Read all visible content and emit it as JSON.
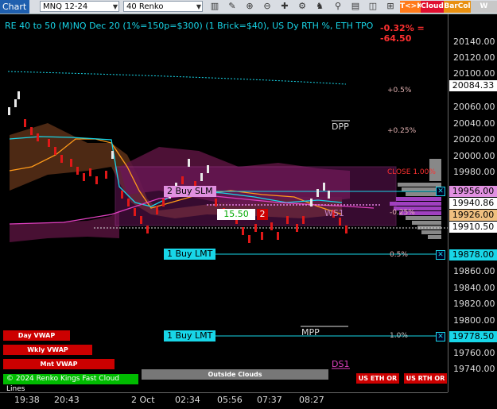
{
  "toolbar": {
    "chart_label": "Chart",
    "instrument": "MNQ 12-24",
    "bar_type": "40 Renko",
    "buttons": {
      "tk": "T<>K",
      "cloud": "Cloud",
      "barcol": "BarCol",
      "vwap": "W VWA"
    }
  },
  "chart": {
    "title": "RE 40 to 50 (M)NQ Dec 20 (1%=150p=$300) (1 Brick=$40), US Dy RTH %, ETH TPO",
    "change": "-0.32% = -64.50",
    "colors": {
      "cyan": "#18d6e8",
      "orange": "#ff9a1a",
      "magenta": "#e040c0",
      "red": "#e01818",
      "white": "#e0e0e0"
    }
  },
  "price_axis": {
    "labels": [
      "20140.00",
      "20120.00",
      "20100.00",
      "20084.33",
      "20060.00",
      "20040.00",
      "20020.00",
      "20000.00",
      "19980.00",
      "19956.00",
      "19940.86",
      "19926.00",
      "19910.50",
      "19878.00",
      "19860.00",
      "19840.00",
      "19820.00",
      "19800.00",
      "19778.50",
      "19760.00",
      "19740.00"
    ],
    "tags": {
      "t1": "20084.33",
      "t2": "19956.00",
      "t3": "19940.86",
      "t4": "19926.00",
      "t5": "19910.50",
      "t6": "19878.00",
      "t7": "19778.50"
    }
  },
  "time_axis": {
    "labels": [
      "19:38",
      "20:43",
      "2 Oct",
      "02:34",
      "05:56",
      "07:37",
      "08:27"
    ]
  },
  "orders": {
    "buy_slm": "2 Buy SLM",
    "buy_lmt1": "1 Buy LMT",
    "buy_lmt2": "1 Buy LMT",
    "qty_value": "15.50",
    "qty_count": "2"
  },
  "annotations": {
    "pct_05_top": "+0.5%",
    "pct_025_top": "+0.25%",
    "close": "CLOSE 1.00%",
    "pct_025_neg": "-0.25%",
    "pct_05_neg": "0.5%",
    "pct_1_neg": "1.0%",
    "dpp": "DPP",
    "mpp": "MPP",
    "ds1": "DS1",
    "ws1": "WS1"
  },
  "legend_buttons": {
    "day_vwap": "Day VWAP",
    "wkly_vwap": "Wkly VWAP",
    "mnt_vwap": "Mnt VWAP",
    "outside_clouds": "Outside Clouds",
    "green": "© 2024 Renko Kings Fast Cloud Lines",
    "us_eth_or": "US ETH OR",
    "us_rth_or": "US RTH OR"
  }
}
